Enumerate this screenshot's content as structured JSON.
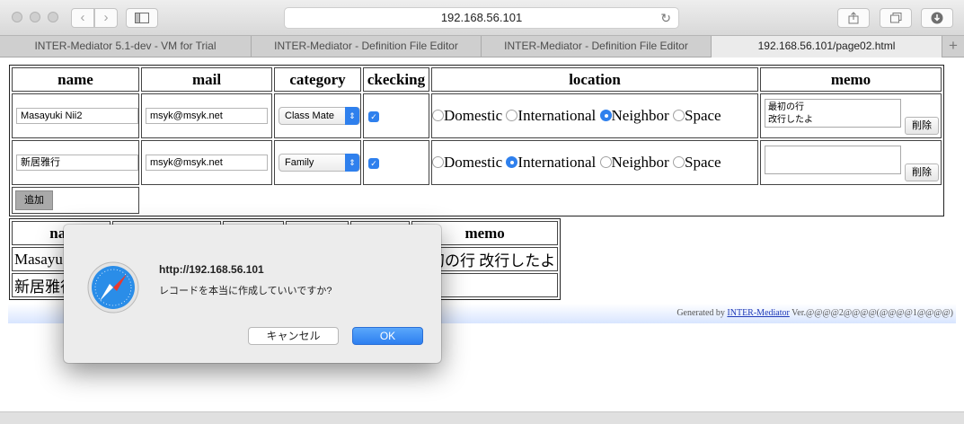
{
  "browser": {
    "url": "192.168.56.101",
    "tabs": [
      {
        "label": "INTER-Mediator 5.1-dev - VM for Trial"
      },
      {
        "label": "INTER-Mediator - Definition File Editor"
      },
      {
        "label": "INTER-Mediator - Definition File Editor"
      },
      {
        "label": "192.168.56.101/page02.html"
      }
    ],
    "new_tab_label": "+"
  },
  "main_table": {
    "headers": [
      "name",
      "mail",
      "category",
      "ckecking",
      "location",
      "memo"
    ],
    "rows": [
      {
        "name": "Masayuki Nii2",
        "mail": "msyk@msyk.net",
        "category": "Class Mate",
        "memo": "最初の行\n改行したよ",
        "location_selected": "Neighbor"
      },
      {
        "name": "新居雅行",
        "mail": "msyk@msyk.net",
        "category": "Family",
        "memo": "",
        "location_selected": "International"
      }
    ],
    "location_options": [
      "Domestic",
      "International",
      "Neighbor",
      "Space"
    ],
    "delete_label": "削除",
    "add_label": "追加"
  },
  "second_table": {
    "headers": [
      "nar",
      "",
      "",
      "",
      "",
      "memo"
    ],
    "rows": [
      {
        "name": "Masayu",
        "memo": "最初の行 改行したよ"
      },
      {
        "name": "新居雅行",
        "memo": ""
      }
    ]
  },
  "footer": {
    "prefix": "Generated by ",
    "link": "INTER-Mediator",
    "suffix": " Ver.@@@@2@@@@(@@@@1@@@@)"
  },
  "dialog": {
    "title": "http://192.168.56.101",
    "message": "レコードを本当に作成していいですか?",
    "cancel_label": "キャンセル",
    "ok_label": "OK"
  },
  "colors": {
    "accent": "#2f80ed",
    "footer_link": "#1f3ab8"
  }
}
